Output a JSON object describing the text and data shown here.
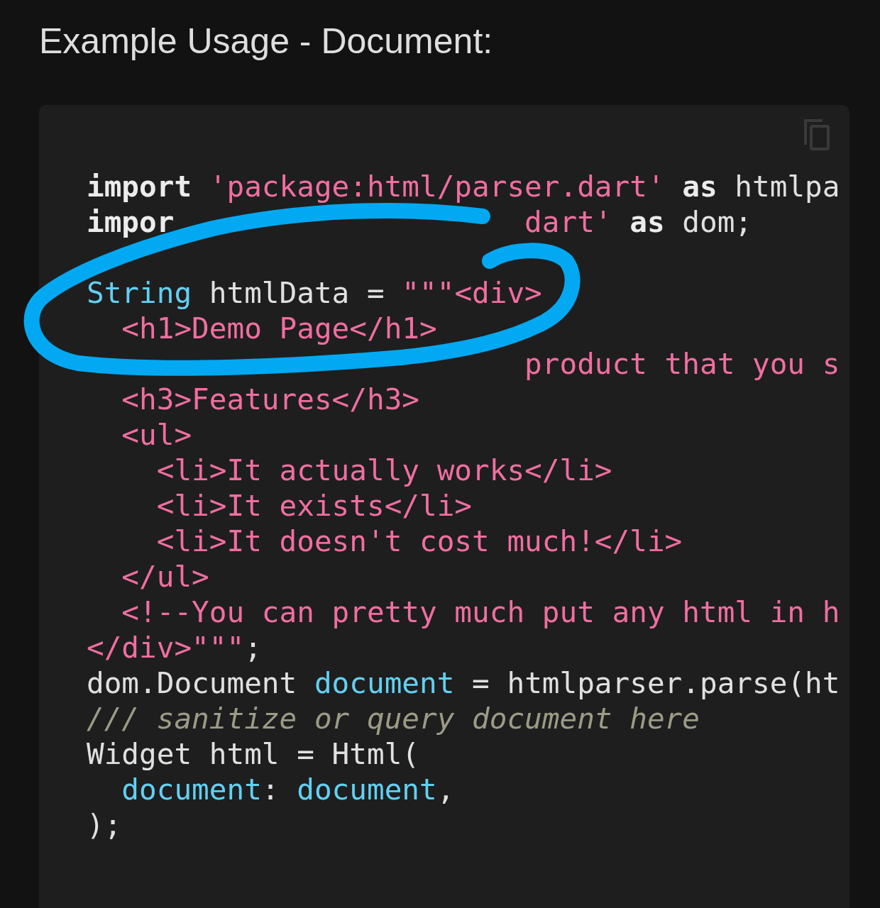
{
  "title": "Example Usage - Document:",
  "code_block": {
    "lines": [
      {
        "tokens": [
          {
            "kind": "keyword",
            "text": "import "
          },
          {
            "kind": "string",
            "text": "'package:html/parser.dart' "
          },
          {
            "kind": "keyword",
            "text": "as "
          },
          {
            "kind": "plain",
            "text": "htmlpa"
          }
        ]
      },
      {
        "kind": "code",
        "tokens": [
          {
            "kind": "keyword",
            "text": "impor                    "
          },
          {
            "kind": "string",
            "text": "dart' "
          },
          {
            "kind": "keyword",
            "text": "as "
          },
          {
            "kind": "plain",
            "text": "dom;"
          }
        ]
      },
      {
        "kind": "blank"
      },
      {
        "tokens": [
          {
            "kind": "type",
            "text": "String "
          },
          {
            "kind": "plain",
            "text": "htmlData = "
          },
          {
            "kind": "string",
            "text": "\"\"\"<div>"
          }
        ]
      },
      {
        "tokens": [
          {
            "kind": "string",
            "text": "  <h1>Demo Page</h1>"
          }
        ]
      },
      {
        "tokens": [
          {
            "kind": "string",
            "text": "                         product that you s"
          }
        ]
      },
      {
        "tokens": [
          {
            "kind": "string",
            "text": "  <h3>Features</h3>"
          }
        ]
      },
      {
        "tokens": [
          {
            "kind": "string",
            "text": "  <ul>"
          }
        ]
      },
      {
        "tokens": [
          {
            "kind": "string",
            "text": "    <li>It actually works</li>"
          }
        ]
      },
      {
        "tokens": [
          {
            "kind": "string",
            "text": "    <li>It exists</li>"
          }
        ]
      },
      {
        "tokens": [
          {
            "kind": "string",
            "text": "    <li>It doesn't cost much!</li>"
          }
        ]
      },
      {
        "tokens": [
          {
            "kind": "string",
            "text": "  </ul>"
          }
        ]
      },
      {
        "tokens": [
          {
            "kind": "string",
            "text": "  <!--You can pretty much put any html in h"
          }
        ]
      },
      {
        "tokens": [
          {
            "kind": "string",
            "text": "</div>\"\"\""
          },
          {
            "kind": "plain",
            "text": ";"
          }
        ]
      },
      {
        "tokens": [
          {
            "kind": "plain",
            "text": "dom.Document "
          },
          {
            "kind": "type",
            "text": "document"
          },
          {
            "kind": "plain",
            "text": " = htmlparser.parse(ht"
          }
        ]
      },
      {
        "tokens": [
          {
            "kind": "comment",
            "text": "/// sanitize or query document here"
          }
        ]
      },
      {
        "tokens": [
          {
            "kind": "plain",
            "text": "Widget html = Html("
          }
        ]
      },
      {
        "tokens": [
          {
            "kind": "type",
            "text": "  document"
          },
          {
            "kind": "plain",
            "text": ": "
          },
          {
            "kind": "type",
            "text": "document"
          },
          {
            "kind": "plain",
            "text": ","
          }
        ]
      },
      {
        "tokens": [
          {
            "kind": "plain",
            "text": ");"
          }
        ]
      }
    ]
  }
}
